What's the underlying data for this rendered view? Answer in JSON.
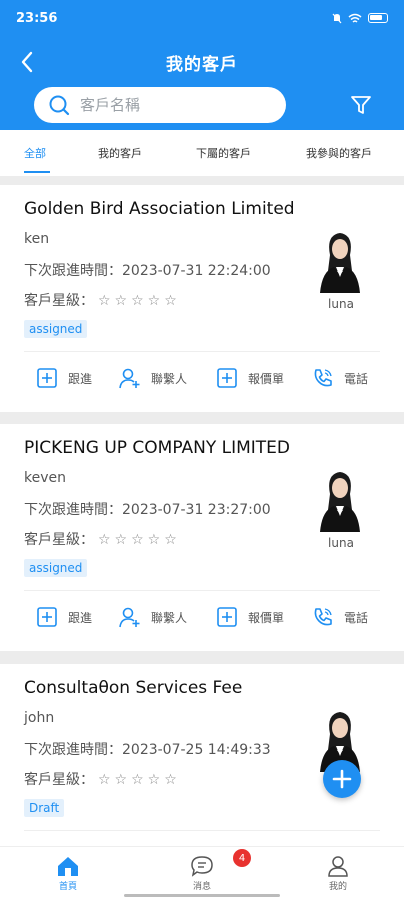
{
  "status_bar": {
    "time": "23:56",
    "battery": "62"
  },
  "header": {
    "title": "我的客戶"
  },
  "search": {
    "placeholder": "客戶名稱"
  },
  "tabs": [
    {
      "label": "全部",
      "active": true
    },
    {
      "label": "我的客戶",
      "active": false
    },
    {
      "label": "下屬的客戶",
      "active": false
    },
    {
      "label": "我參與的客戶",
      "active": false
    }
  ],
  "labels": {
    "follow_time": "下次跟進時間：",
    "rating": "客戶星級：",
    "stars": "☆☆☆☆☆"
  },
  "actions": {
    "follow": "跟進",
    "contact": "聯繫人",
    "quote": "報價單",
    "phone": "電話"
  },
  "customers": [
    {
      "name": "Golden Bird Association Limited",
      "contact": "ken",
      "follow_time": "2023-07-31 22:24:00",
      "status": "assigned",
      "owner": "luna"
    },
    {
      "name": "PICKENG UP COMPANY LIMITED",
      "contact": "keven",
      "follow_time": "2023-07-31 23:27:00",
      "status": "assigned",
      "owner": "luna"
    },
    {
      "name": "Consultaθon Services Fee",
      "contact": "john",
      "follow_time": "2023-07-25 14:49:33",
      "status": "Draft",
      "owner": ""
    }
  ],
  "bottom_nav": [
    {
      "label": "首頁",
      "icon": "home-icon",
      "active": true
    },
    {
      "label": "消息",
      "icon": "message-icon",
      "active": false,
      "badge": "4"
    },
    {
      "label": "我的",
      "icon": "user-icon",
      "active": false
    }
  ],
  "colors": {
    "primary": "#1f8ff2",
    "badge_red": "#e8322f",
    "tag_bg": "#e3f0fc"
  }
}
